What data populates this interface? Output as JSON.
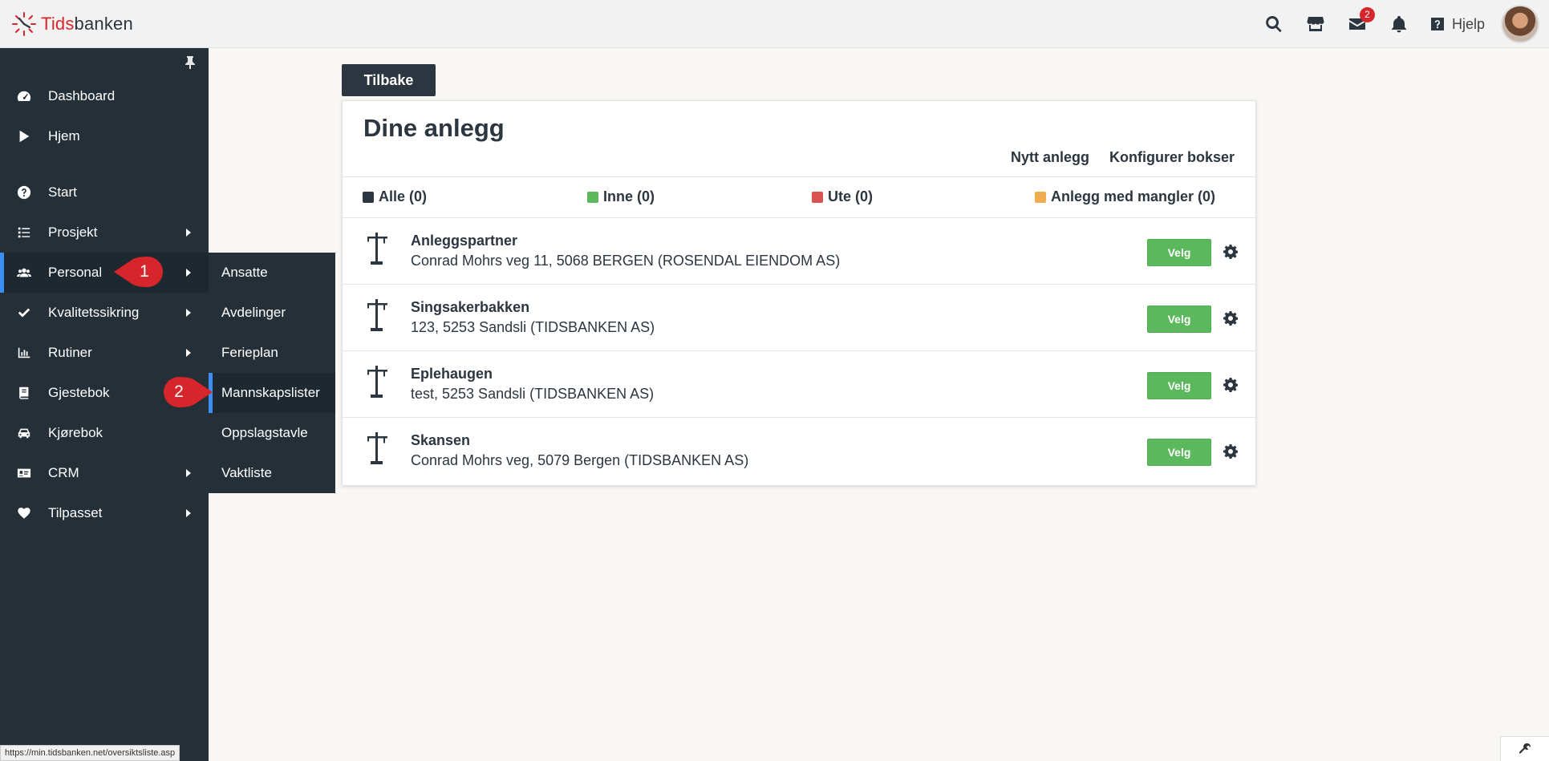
{
  "header": {
    "logo_prefix": "Tids",
    "logo_suffix": "banken",
    "mail_badge": "2",
    "help_label": "Hjelp"
  },
  "sidebar": {
    "items": [
      {
        "label": "Dashboard",
        "icon": "gauge-icon"
      },
      {
        "label": "Hjem",
        "icon": "play-icon"
      },
      {
        "label": "Start",
        "icon": "question-circle-icon"
      },
      {
        "label": "Prosjekt",
        "icon": "list-icon"
      },
      {
        "label": "Personal",
        "icon": "users-icon"
      },
      {
        "label": "Kvalitetssikring",
        "icon": "check-icon"
      },
      {
        "label": "Rutiner",
        "icon": "chart-icon"
      },
      {
        "label": "Gjestebok",
        "icon": "book-icon"
      },
      {
        "label": "Kjørebok",
        "icon": "car-icon"
      },
      {
        "label": "CRM",
        "icon": "id-card-icon"
      },
      {
        "label": "Tilpasset",
        "icon": "heart-icon"
      }
    ]
  },
  "submenu": {
    "items": [
      "Ansatte",
      "Avdelinger",
      "Ferieplan",
      "Mannskapslister",
      "Oppslagstavle",
      "Vaktliste"
    ]
  },
  "markers": {
    "first": "1",
    "second": "2"
  },
  "main": {
    "back_label": "Tilbake",
    "title": "Dine anlegg",
    "new_site_link": "Nytt anlegg",
    "configure_link": "Konfigurer bokser",
    "filters": [
      {
        "label": "Alle (0)",
        "color": "#2c3640"
      },
      {
        "label": "Inne (0)",
        "color": "#5cb85c"
      },
      {
        "label": "Ute (0)",
        "color": "#d9534f"
      },
      {
        "label": "Anlegg med mangler (0)",
        "color": "#f0ad4e"
      }
    ],
    "select_label": "Velg",
    "sites": [
      {
        "name": "Anleggspartner",
        "address": "Conrad Mohrs veg 11, 5068 BERGEN (ROSENDAL EIENDOM AS)"
      },
      {
        "name": "Singsakerbakken",
        "address": "123, 5253 Sandsli (TIDSBANKEN AS)"
      },
      {
        "name": "Eplehaugen",
        "address": "test, 5253 Sandsli (TIDSBANKEN AS)"
      },
      {
        "name": "Skansen",
        "address": "Conrad Mohrs veg, 5079 Bergen (TIDSBANKEN AS)"
      }
    ]
  },
  "status_bar": {
    "url": "https://min.tidsbanken.net/oversiktsliste.asp"
  }
}
